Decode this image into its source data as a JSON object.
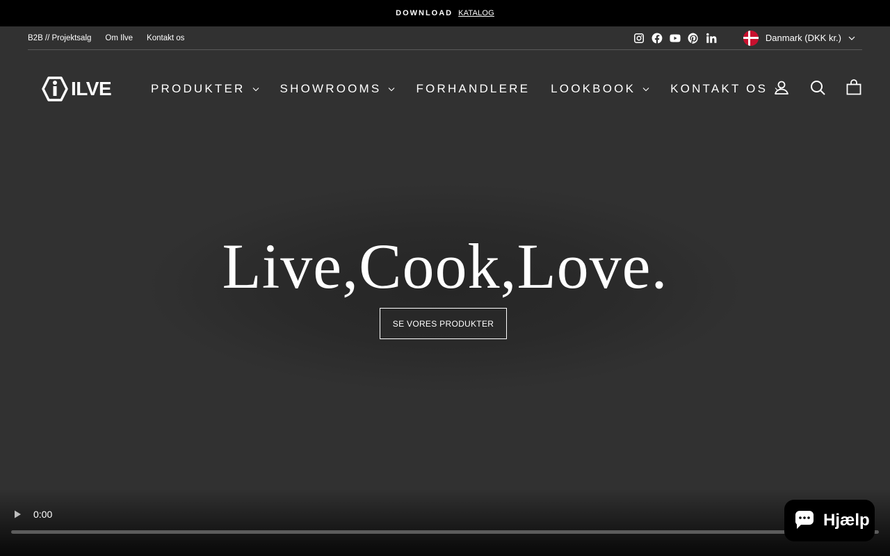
{
  "announcement": {
    "lead": "DOWNLOAD",
    "link": "KATALOG"
  },
  "utility": {
    "links": [
      "B2B // Projektsalg",
      "Om Ilve",
      "Kontakt os"
    ],
    "socials": [
      "instagram-icon",
      "facebook-icon",
      "youtube-icon",
      "pinterest-icon",
      "linkedin-icon"
    ],
    "country": "Danmark (DKK kr.)"
  },
  "header": {
    "logo": "ILVE",
    "nav": [
      {
        "label": "PRODUKTER",
        "dropdown": true
      },
      {
        "label": "SHOWROOMS",
        "dropdown": true
      },
      {
        "label": "FORHANDLERE",
        "dropdown": false
      },
      {
        "label": "LOOKBOOK",
        "dropdown": true
      },
      {
        "label": "KONTAKT OS",
        "dropdown": true
      }
    ],
    "icons": [
      "account-icon",
      "search-icon",
      "cart-icon"
    ]
  },
  "hero": {
    "title": "Live,Cook,Love.",
    "button": "SE VORES PRODUKTER"
  },
  "video": {
    "time": "0:00",
    "progress": 0.0
  },
  "chat": {
    "label": "Hjælp"
  },
  "colors": {
    "background": "#313131",
    "bar": "#000000",
    "text": "#ffffff"
  }
}
